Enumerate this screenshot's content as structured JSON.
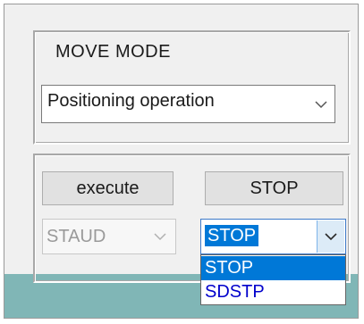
{
  "move_mode": {
    "label": "MOVE MODE",
    "select_value": "Positioning operation"
  },
  "buttons": {
    "execute_label": "execute",
    "stop_label": "STOP"
  },
  "stop_mode_combo": {
    "disabled_value": "STAUD",
    "value": "STOP",
    "options": [
      "STOP",
      "SDSTP"
    ],
    "highlighted_option": "STOP"
  },
  "colors": {
    "accent": "#0078d7",
    "panel_background": "#f0f0f0",
    "footer_teal": "#80b6b6"
  },
  "icons": [
    "chevron-down-icon"
  ]
}
